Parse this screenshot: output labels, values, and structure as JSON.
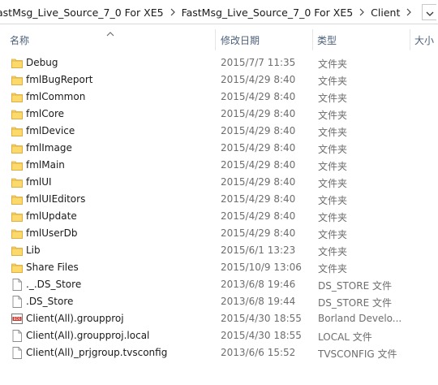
{
  "breadcrumb": {
    "parts": [
      "astMsg_Live_Source_7_0 For XE5",
      "FastMsg_Live_Source_7_0 For XE5",
      "Client"
    ]
  },
  "columns": {
    "name": "名称",
    "date": "修改日期",
    "type": "类型",
    "size": "大小"
  },
  "files": [
    {
      "name": "Debug",
      "date": "2015/7/7 11:35",
      "type": "文件夹",
      "icon": "folder"
    },
    {
      "name": "fmlBugReport",
      "date": "2015/4/29 8:40",
      "type": "文件夹",
      "icon": "folder"
    },
    {
      "name": "fmlCommon",
      "date": "2015/4/29 8:40",
      "type": "文件夹",
      "icon": "folder"
    },
    {
      "name": "fmlCore",
      "date": "2015/4/29 8:40",
      "type": "文件夹",
      "icon": "folder"
    },
    {
      "name": "fmlDevice",
      "date": "2015/4/29 8:40",
      "type": "文件夹",
      "icon": "folder"
    },
    {
      "name": "fmlImage",
      "date": "2015/4/29 8:40",
      "type": "文件夹",
      "icon": "folder"
    },
    {
      "name": "fmlMain",
      "date": "2015/4/29 8:40",
      "type": "文件夹",
      "icon": "folder"
    },
    {
      "name": "fmlUI",
      "date": "2015/4/29 8:40",
      "type": "文件夹",
      "icon": "folder"
    },
    {
      "name": "fmlUIEditors",
      "date": "2015/4/29 8:40",
      "type": "文件夹",
      "icon": "folder"
    },
    {
      "name": "fmlUpdate",
      "date": "2015/4/29 8:40",
      "type": "文件夹",
      "icon": "folder"
    },
    {
      "name": "fmlUserDb",
      "date": "2015/4/29 8:40",
      "type": "文件夹",
      "icon": "folder"
    },
    {
      "name": "Lib",
      "date": "2015/6/1 13:23",
      "type": "文件夹",
      "icon": "folder"
    },
    {
      "name": "Share Files",
      "date": "2015/10/9 13:06",
      "type": "文件夹",
      "icon": "folder"
    },
    {
      "name": "._.DS_Store",
      "date": "2013/6/8 19:46",
      "type": "DS_STORE 文件",
      "icon": "file"
    },
    {
      "name": ".DS_Store",
      "date": "2013/6/8 19:44",
      "type": "DS_STORE 文件",
      "icon": "file"
    },
    {
      "name": "Client(All).groupproj",
      "date": "2015/4/30 18:55",
      "type": "Borland Develo...",
      "icon": "bds"
    },
    {
      "name": "Client(All).groupproj.local",
      "date": "2015/4/30 18:55",
      "type": "LOCAL 文件",
      "icon": "file"
    },
    {
      "name": "Client(All)_prjgroup.tvsconfig",
      "date": "2013/6/6 15:52",
      "type": "TVSCONFIG 文件",
      "icon": "file"
    }
  ]
}
